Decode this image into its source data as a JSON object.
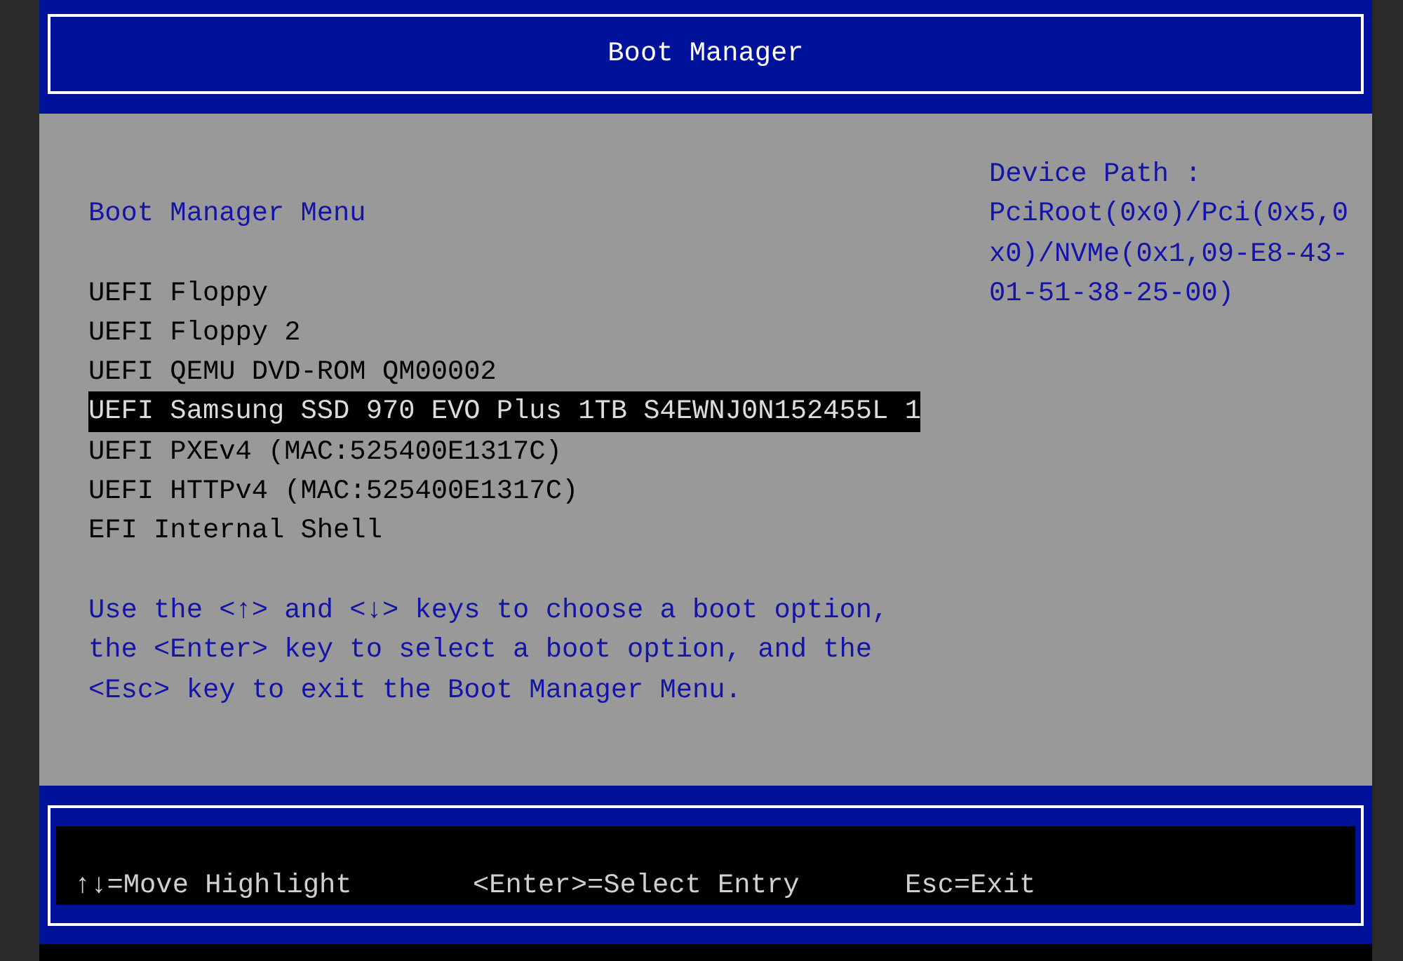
{
  "title": "Boot Manager",
  "menu": {
    "heading": "Boot Manager Menu",
    "items": [
      {
        "label": "UEFI Floppy",
        "selected": false
      },
      {
        "label": "UEFI Floppy 2",
        "selected": false
      },
      {
        "label": "UEFI QEMU DVD-ROM QM00002",
        "selected": false
      },
      {
        "label": "UEFI Samsung SSD 970 EVO Plus 1TB S4EWNJ0N152455L 1",
        "selected": true
      },
      {
        "label": "UEFI PXEv4 (MAC:525400E1317C)",
        "selected": false
      },
      {
        "label": "UEFI HTTPv4 (MAC:525400E1317C)",
        "selected": false
      },
      {
        "label": "EFI Internal Shell",
        "selected": false
      }
    ]
  },
  "help_text": "Use the <↑> and <↓> keys to choose a boot option, the <Enter> key to select a boot option, and the <Esc> key to exit the Boot Manager Menu.",
  "device_path": {
    "label": "Device Path :",
    "value": "PciRoot(0x0)/Pci(0x5,0x0)/NVMe(0x1,09-E8-43-01-51-38-25-00)"
  },
  "status_bar": [
    "↑↓=Move Highlight",
    "<Enter>=Select Entry",
    "Esc=Exit"
  ]
}
